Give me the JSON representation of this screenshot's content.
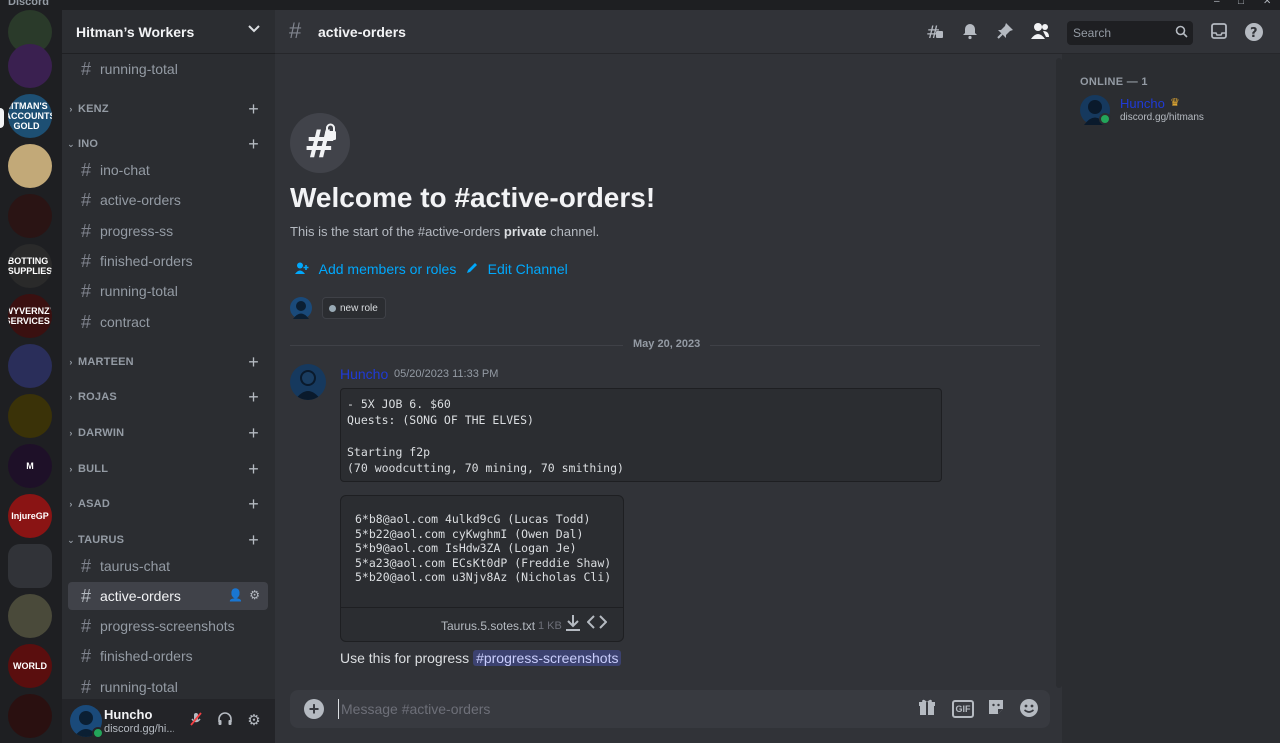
{
  "app_name": "Discord",
  "window_controls": [
    "–",
    "□",
    "✕"
  ],
  "server_rail": [
    {
      "label": "",
      "color": "#2a3a2a"
    },
    {
      "label": "",
      "color": "#3a2050"
    },
    {
      "label": "HITMAN'S ACCOUNTS & GOLD",
      "color": "#1d4f73"
    },
    {
      "label": "",
      "color": "#c2a978"
    },
    {
      "label": "",
      "color": "#2a1414"
    },
    {
      "label": "BOTTING SUPPLIES",
      "color": "#2a2a2a"
    },
    {
      "label": "WYVERNZY SERVICES",
      "color": "#3a1010"
    },
    {
      "label": "",
      "color": "#2a2e5a"
    },
    {
      "label": "",
      "color": "#3a3208"
    },
    {
      "label": "M",
      "color": "#1e1028"
    },
    {
      "label": "InjureGP",
      "color": "#8a1414"
    },
    {
      "label": "",
      "color": "#313338"
    },
    {
      "label": "",
      "color": "#4a4a3a"
    },
    {
      "label": "WORLD",
      "color": "#5a0e0e"
    },
    {
      "label": "",
      "color": "#2a1010"
    }
  ],
  "server": {
    "name": "Hitman’s Workers"
  },
  "sidebar": {
    "items": [
      {
        "kind": "channel",
        "label": "running-total"
      },
      {
        "kind": "category",
        "label": "KENZ",
        "collapsed": true
      },
      {
        "kind": "category",
        "label": "INO",
        "collapsed": false
      },
      {
        "kind": "channel",
        "label": "ino-chat"
      },
      {
        "kind": "channel",
        "label": "active-orders"
      },
      {
        "kind": "channel",
        "label": "progress-ss"
      },
      {
        "kind": "channel",
        "label": "finished-orders"
      },
      {
        "kind": "channel",
        "label": "running-total"
      },
      {
        "kind": "channel",
        "label": "contract"
      },
      {
        "kind": "category",
        "label": "MARTEEN",
        "collapsed": true
      },
      {
        "kind": "category",
        "label": "ROJAS",
        "collapsed": true
      },
      {
        "kind": "category",
        "label": "DARWIN",
        "collapsed": true
      },
      {
        "kind": "category",
        "label": "BULL",
        "collapsed": true
      },
      {
        "kind": "category",
        "label": "ASAD",
        "collapsed": true
      },
      {
        "kind": "category",
        "label": "TAURUS",
        "collapsed": false
      },
      {
        "kind": "channel",
        "label": "taurus-chat"
      },
      {
        "kind": "channel",
        "label": "active-orders",
        "active": true
      },
      {
        "kind": "channel",
        "label": "progress-screenshots"
      },
      {
        "kind": "channel",
        "label": "finished-orders"
      },
      {
        "kind": "channel",
        "label": "running-total"
      }
    ]
  },
  "user_panel": {
    "username": "Huncho",
    "status": "discord.gg/hi..."
  },
  "header": {
    "channel": "active-orders",
    "search_placeholder": "Search"
  },
  "welcome": {
    "title": "Welcome to #active-orders!",
    "subtitle_pre": "This is the start of the #active-orders ",
    "subtitle_bold": "private",
    "subtitle_post": " channel.",
    "add_members": "Add members or roles",
    "edit_channel": "Edit Channel",
    "role_chip": "new role"
  },
  "divider_date": "May 20, 2023",
  "message": {
    "author": "Huncho",
    "timestamp": "05/20/2023 11:33 PM",
    "code": "- 5X JOB 6. $60\nQuests: (SONG OF THE ELVES)\n\nStarting f2p\n(70 woodcutting, 70 mining, 70 smithing)",
    "attachment_lines": "6*b8@aol.com 4ulkd9cG (Lucas Todd)\n5*b22@aol.com cyKwghmI (Owen Dal)\n5*b9@aol.com IsHdw3ZA (Logan Je)\n5*a23@aol.com ECsKt0dP (Freddie Shaw)\n5*b20@aol.com u3Njv8Az (Nicholas Cli)",
    "attachment_name": "Taurus.5.sotes.txt",
    "attachment_size": "1 KB",
    "text": "Use this for progress",
    "mention": "#progress-screenshots"
  },
  "composer": {
    "placeholder": "Message #active-orders"
  },
  "members": {
    "heading": "ONLINE — 1",
    "name": "Huncho",
    "status": "discord.gg/hitmans"
  }
}
